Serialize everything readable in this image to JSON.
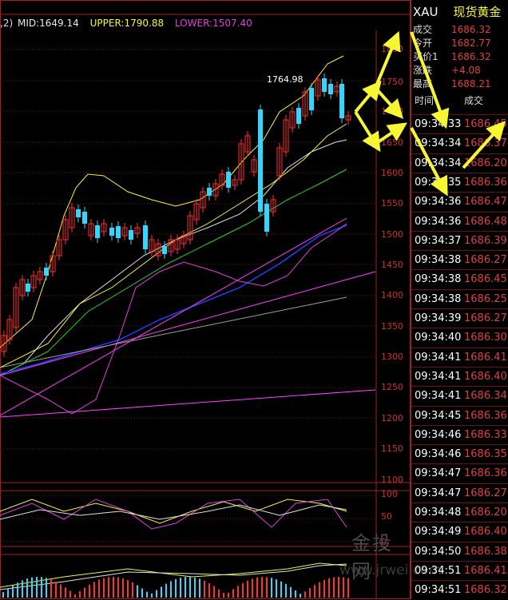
{
  "indicator_header": {
    "paren": ",2)",
    "mid": "MID:1649.14",
    "upper": "UPPER:1790.88",
    "lower": "LOWER:1507.40"
  },
  "axis": {
    "price_ticks": [
      "1800",
      "1750",
      "1700",
      "1650",
      "1600",
      "1550",
      "1500",
      "1450",
      "1400",
      "1350",
      "1300",
      "1250",
      "1200",
      "1150",
      "1100"
    ],
    "osc_ticks": [
      "100",
      "50",
      "0"
    ],
    "peak_label": "1764.98"
  },
  "symbol": {
    "code": "XAU",
    "name": "现货黄金"
  },
  "quote": [
    {
      "label": "成交",
      "value": "1686.32"
    },
    {
      "label": "今开",
      "value": "1682.77"
    },
    {
      "label": "买价1",
      "value": "1686.32"
    },
    {
      "label": "涨跌",
      "value": "+4.08"
    },
    {
      "label": "最高",
      "value": "1688.21"
    }
  ],
  "trades_header": {
    "time": "时间",
    "volume": "成交"
  },
  "trades": [
    {
      "time": "09:34:33",
      "price": "1686.45"
    },
    {
      "time": "09:34:34",
      "price": "1686.37"
    },
    {
      "time": "09:34:34",
      "price": "1686.20"
    },
    {
      "time": "09:34:35",
      "price": "1686.36"
    },
    {
      "time": "09:34:36",
      "price": "1686.47"
    },
    {
      "time": "09:34:36",
      "price": "1686.48"
    },
    {
      "time": "09:34:37",
      "price": "1686.39"
    },
    {
      "time": "09:34:38",
      "price": "1686.27"
    },
    {
      "time": "09:34:38",
      "price": "1686.45"
    },
    {
      "time": "09:34:38",
      "price": "1686.25"
    },
    {
      "time": "09:34:39",
      "price": "1686.27"
    },
    {
      "time": "09:34:40",
      "price": "1686.30"
    },
    {
      "time": "09:34:41",
      "price": "1686.41"
    },
    {
      "time": "09:34:41",
      "price": "1686.40"
    },
    {
      "time": "09:34:41",
      "price": "1686.34"
    },
    {
      "time": "09:34:45",
      "price": "1686.36"
    },
    {
      "time": "09:34:46",
      "price": "1686.33"
    },
    {
      "time": "09:34:46",
      "price": "1686.35"
    },
    {
      "time": "09:34:47",
      "price": "1686.36"
    },
    {
      "time": "09:34:47",
      "price": "1686.27"
    },
    {
      "time": "09:34:48",
      "price": "1686.20"
    },
    {
      "time": "09:34:49",
      "price": "1686.40"
    },
    {
      "time": "09:34:50",
      "price": "1686.38"
    },
    {
      "time": "09:34:51",
      "price": "1686.41"
    },
    {
      "time": "09:34:51",
      "price": "1686.32"
    }
  ],
  "watermark": {
    "logo": "金投网",
    "site": "www.jrwei.com"
  },
  "colors": {
    "up": "#ff3030",
    "down": "#30d8ff",
    "upper": "#f6f635",
    "lower": "#e040e0",
    "accent": "#f6f635"
  }
}
